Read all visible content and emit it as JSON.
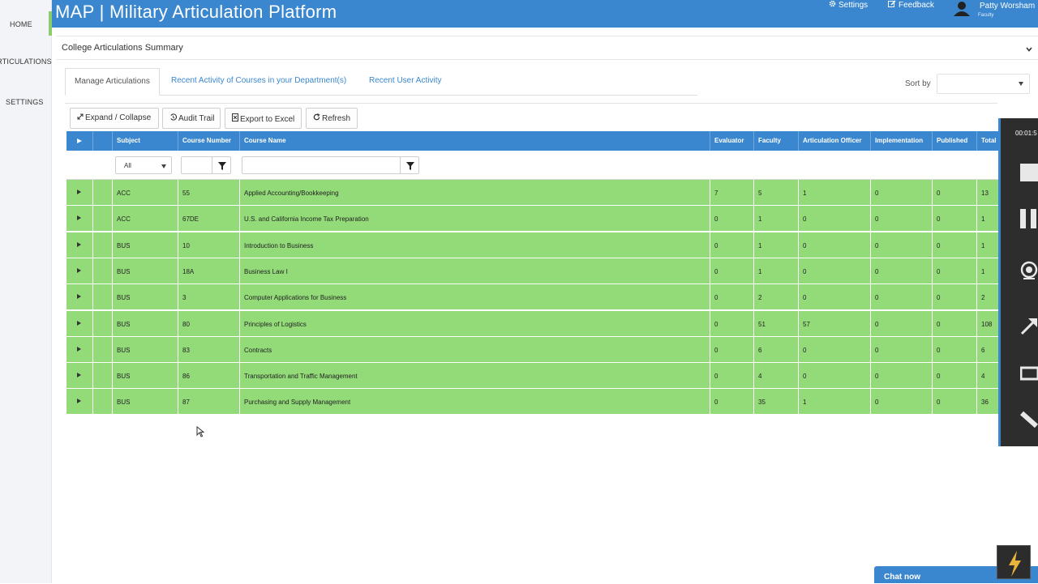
{
  "sidebar": {
    "items": [
      {
        "label": "HOME"
      },
      {
        "label": "ARTICULATIONS"
      },
      {
        "label": "SETTINGS"
      }
    ]
  },
  "header": {
    "title": "MAP | Military Articulation Platform",
    "settings_label": "Settings",
    "feedback_label": "Feedback",
    "user_name": "Patty Worsham",
    "user_role": "Faculty"
  },
  "summary": {
    "title": "College Articulations Summary"
  },
  "tabs": [
    {
      "label": "Manage Articulations",
      "active": true
    },
    {
      "label": "Recent Activity of Courses in your Department(s)"
    },
    {
      "label": "Recent User Activity"
    }
  ],
  "sort": {
    "label": "Sort by",
    "value": ""
  },
  "toolbar": {
    "expand_label": "Expand / Collapse",
    "audit_label": "Audit Trail",
    "export_label": "Export to Excel",
    "refresh_label": "Refresh"
  },
  "grid": {
    "columns": [
      "Subject",
      "Course Number",
      "Course Name",
      "Evaluator",
      "Faculty",
      "Articulation Officer",
      "Implementation",
      "Published",
      "Total"
    ],
    "filters": {
      "subject_value": "All",
      "course_number_value": "",
      "course_name_value": ""
    },
    "rows": [
      {
        "subject": "ACC",
        "number": "55",
        "name": "Applied Accounting/Bookkeeping",
        "evaluator": "7",
        "faculty": "5",
        "officer": "1",
        "implementation": "0",
        "published": "0",
        "total": "13"
      },
      {
        "subject": "ACC",
        "number": "67DE",
        "name": "U.S. and California Income Tax Preparation",
        "evaluator": "0",
        "faculty": "1",
        "officer": "0",
        "implementation": "0",
        "published": "0",
        "total": "1"
      },
      {
        "subject": "BUS",
        "number": "10",
        "name": "Introduction to Business",
        "evaluator": "0",
        "faculty": "1",
        "officer": "0",
        "implementation": "0",
        "published": "0",
        "total": "1"
      },
      {
        "subject": "BUS",
        "number": "18A",
        "name": "Business Law I",
        "evaluator": "0",
        "faculty": "1",
        "officer": "0",
        "implementation": "0",
        "published": "0",
        "total": "1"
      },
      {
        "subject": "BUS",
        "number": "3",
        "name": "Computer Applications for Business",
        "evaluator": "0",
        "faculty": "2",
        "officer": "0",
        "implementation": "0",
        "published": "0",
        "total": "2"
      },
      {
        "subject": "BUS",
        "number": "80",
        "name": "Principles of Logistics",
        "evaluator": "0",
        "faculty": "51",
        "officer": "57",
        "implementation": "0",
        "published": "0",
        "total": "108"
      },
      {
        "subject": "BUS",
        "number": "83",
        "name": "Contracts",
        "evaluator": "0",
        "faculty": "6",
        "officer": "0",
        "implementation": "0",
        "published": "0",
        "total": "6"
      },
      {
        "subject": "BUS",
        "number": "86",
        "name": "Transportation and Traffic Management",
        "evaluator": "0",
        "faculty": "4",
        "officer": "0",
        "implementation": "0",
        "published": "0",
        "total": "4"
      },
      {
        "subject": "BUS",
        "number": "87",
        "name": "Purchasing and Supply Management",
        "evaluator": "0",
        "faculty": "35",
        "officer": "1",
        "implementation": "0",
        "published": "0",
        "total": "36"
      }
    ]
  },
  "recorder": {
    "time": "00:01:5"
  },
  "chat": {
    "label": "Chat now"
  },
  "colors": {
    "header_blue": "#3a87cf",
    "row_green": "#93db79",
    "recorder_dark": "#2d2d2d"
  }
}
